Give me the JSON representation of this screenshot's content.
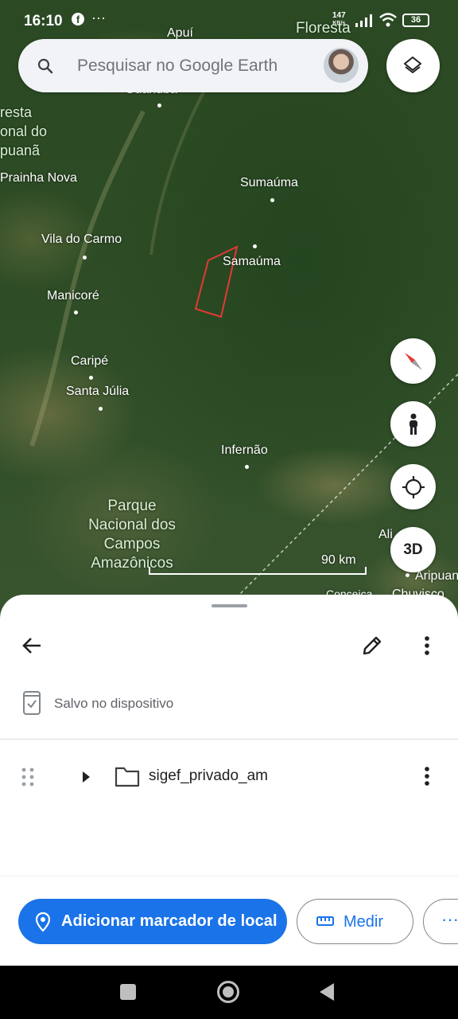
{
  "status_bar": {
    "time": "16:10",
    "facebook_glyph": "f",
    "more": "···",
    "speed_value": "147",
    "speed_unit": "KB/s",
    "battery": "36"
  },
  "search": {
    "placeholder": "Pesquisar no Google Earth"
  },
  "map_labels": [
    "Apuí",
    "Floresta",
    "resta",
    "onal do",
    "puanã",
    "Guariuba",
    "Prainha Nova",
    "Sumaúma",
    "Vila do Carmo",
    "Samaúma",
    "Manicoré",
    "Caripé",
    "Santa Júlia",
    "Infernão",
    "Parque Nacional dos Campos Amazônicos",
    "Ali",
    "Aripuan",
    "Conceiça",
    "Chuvisco"
  ],
  "scale": {
    "label": "90 km"
  },
  "fab": {
    "three_d_label": "3D"
  },
  "sheet": {
    "saved_label": "Salvo no dispositivo",
    "folder_name": "sigef_privado_am"
  },
  "actions": {
    "add_marker_label": "Adicionar marcador de local",
    "measure_label": "Medir",
    "overflow_label": "···"
  },
  "colors": {
    "accent": "#1a73e8",
    "polygon": "#e53935",
    "map_base": "#2d4c25"
  },
  "icons": {
    "search": "search-icon",
    "layers": "layers-icon",
    "compass": "compass-icon",
    "street_view": "pegman-icon",
    "location": "my-location-icon",
    "back": "arrow-back-icon",
    "edit": "pencil-icon",
    "more": "more-vert-icon",
    "saved": "device-saved-icon",
    "drag": "drag-handle-icon",
    "expand": "caret-right-icon",
    "folder": "folder-icon",
    "marker": "place-marker-icon",
    "ruler": "ruler-icon"
  }
}
